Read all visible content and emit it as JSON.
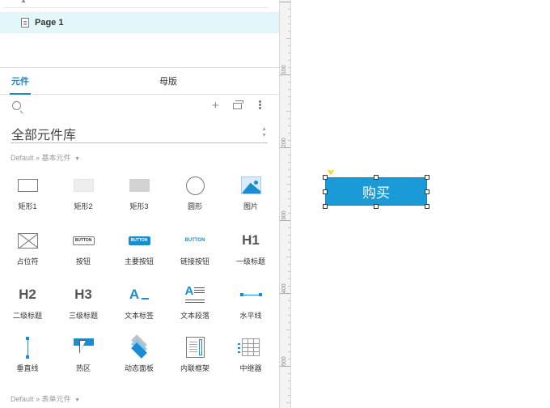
{
  "pages": {
    "items": [
      {
        "label": "Page 1",
        "selected": true
      }
    ]
  },
  "panel": {
    "tabs": [
      {
        "label": "元件",
        "active": true
      },
      {
        "label": "母版",
        "active": false
      }
    ],
    "library": "全部元件库",
    "groups": {
      "basic": {
        "prefix": "Default »",
        "name": "基本元件",
        "arrow": "▼"
      },
      "form": {
        "prefix": "Default »",
        "name": "表单元件",
        "arrow": "▼"
      }
    },
    "widgets": [
      {
        "label": "矩形1",
        "icon": "rectangle-outline-icon"
      },
      {
        "label": "矩形2",
        "icon": "rectangle-light-icon"
      },
      {
        "label": "矩形3",
        "icon": "rectangle-gray-icon"
      },
      {
        "label": "圆形",
        "icon": "circle-icon"
      },
      {
        "label": "图片",
        "icon": "image-icon"
      },
      {
        "label": "占位符",
        "icon": "placeholder-icon"
      },
      {
        "label": "按钮",
        "icon": "button-icon",
        "glyph": "BUTTON"
      },
      {
        "label": "主要按钮",
        "icon": "primary-button-icon",
        "glyph": "BUTTON"
      },
      {
        "label": "链接按钮",
        "icon": "link-button-icon",
        "glyph": "BUTTON"
      },
      {
        "label": "一级标题",
        "icon": "heading1-icon",
        "glyph": "H1"
      },
      {
        "label": "二级标题",
        "icon": "heading2-icon",
        "glyph": "H2"
      },
      {
        "label": "三级标题",
        "icon": "heading3-icon",
        "glyph": "H3"
      },
      {
        "label": "文本标签",
        "icon": "text-label-icon",
        "glyph": "A"
      },
      {
        "label": "文本段落",
        "icon": "text-paragraph-icon",
        "glyph": "A"
      },
      {
        "label": "水平线",
        "icon": "horizontal-line-icon"
      },
      {
        "label": "垂直线",
        "icon": "vertical-line-icon"
      },
      {
        "label": "热区",
        "icon": "hotspot-icon"
      },
      {
        "label": "动态面板",
        "icon": "dynamic-panel-icon"
      },
      {
        "label": "内联框架",
        "icon": "inline-frame-icon"
      },
      {
        "label": "中继器",
        "icon": "repeater-icon"
      }
    ]
  },
  "ruler": {
    "labels": [
      "100",
      "200",
      "300",
      "400",
      "500"
    ]
  },
  "canvas": {
    "button_text": "购买",
    "button_color": "#1a9ad6"
  },
  "colors": {
    "accent": "#1e88c9",
    "selected_page_bg": "#e3f7fa"
  }
}
